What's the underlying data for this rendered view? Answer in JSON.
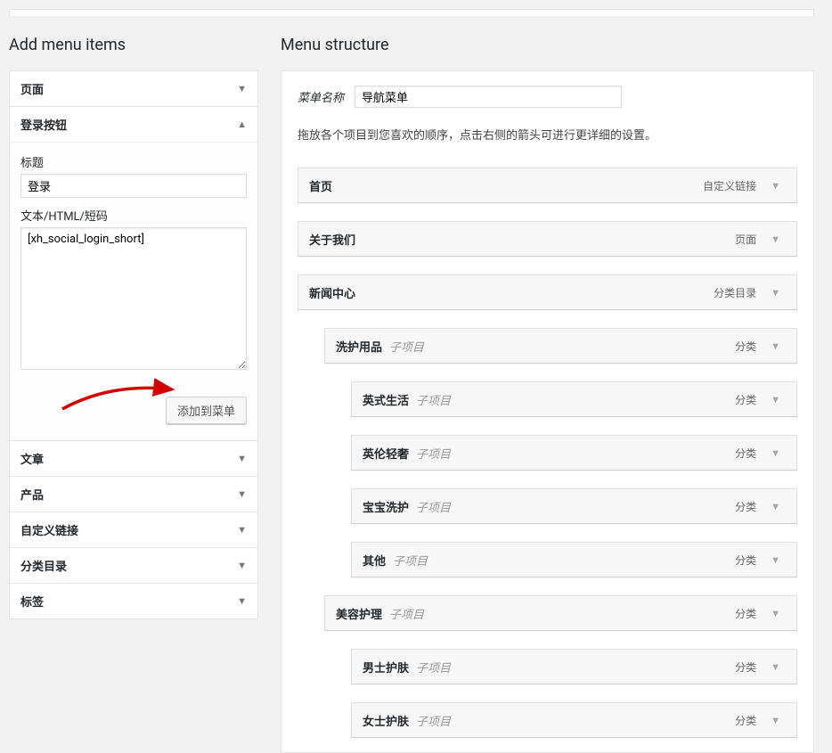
{
  "left": {
    "title": "Add menu items",
    "accordions": {
      "page": {
        "label": "页面"
      },
      "login_btn": {
        "label": "登录按钮",
        "title_label": "标题",
        "title_value": "登录",
        "shortcode_label": "文本/HTML/短码",
        "shortcode_value": "[xh_social_login_short]",
        "submit": "添加到菜单"
      },
      "post": {
        "label": "文章"
      },
      "product": {
        "label": "产品"
      },
      "custom_link": {
        "label": "自定义链接"
      },
      "category": {
        "label": "分类目录"
      },
      "tag": {
        "label": "标签"
      }
    }
  },
  "right": {
    "title": "Menu structure",
    "menu_name_label": "菜单名称",
    "menu_name_value": "导航菜单",
    "instructions": "拖放各个项目到您喜欢的顺序，点击右侧的箭头可进行更详细的设置。",
    "subitem_label": "子项目",
    "items": [
      {
        "title": "首页",
        "type": "自定义链接",
        "depth": 0
      },
      {
        "title": "关于我们",
        "type": "页面",
        "depth": 0
      },
      {
        "title": "新闻中心",
        "type": "分类目录",
        "depth": 0
      },
      {
        "title": "洗护用品",
        "type": "分类",
        "depth": 1
      },
      {
        "title": "英式生活",
        "type": "分类",
        "depth": 2
      },
      {
        "title": "英伦轻奢",
        "type": "分类",
        "depth": 2
      },
      {
        "title": "宝宝洗护",
        "type": "分类",
        "depth": 2
      },
      {
        "title": "其他",
        "type": "分类",
        "depth": 2
      },
      {
        "title": "美容护理",
        "type": "分类",
        "depth": 1
      },
      {
        "title": "男士护肤",
        "type": "分类",
        "depth": 2
      },
      {
        "title": "女士护肤",
        "type": "分类",
        "depth": 2
      }
    ]
  }
}
